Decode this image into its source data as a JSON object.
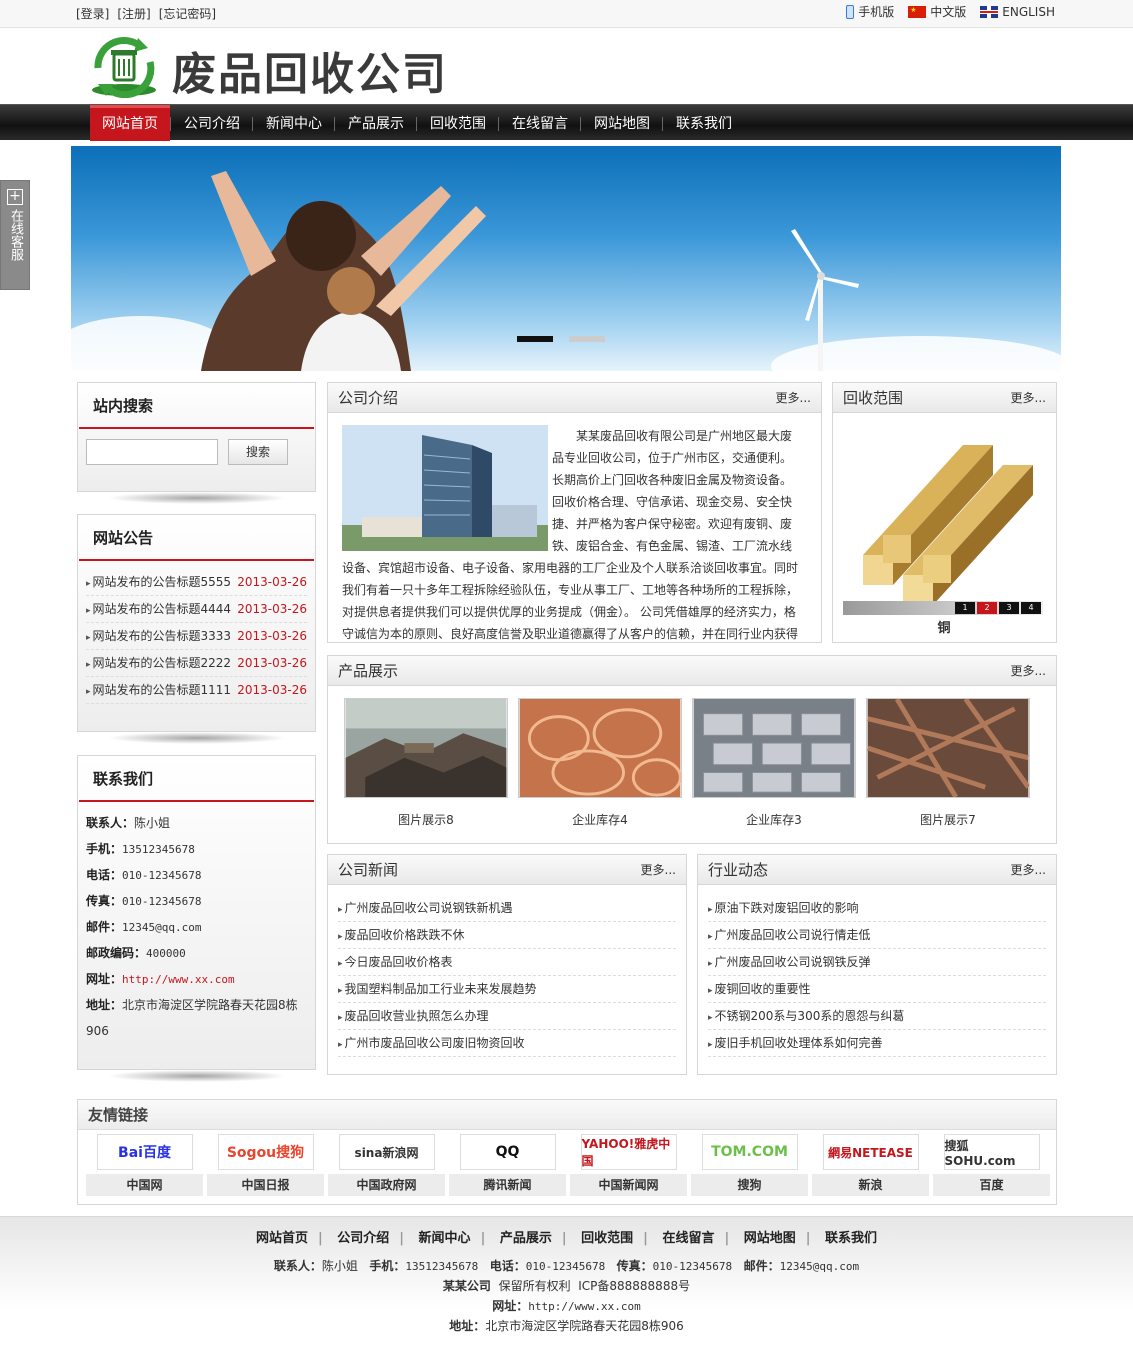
{
  "top": {
    "login": "[登录]",
    "register": "[注册]",
    "forgot": "[忘记密码]",
    "mobile": "手机版",
    "chinese": "中文版",
    "english": "ENGLISH"
  },
  "header": {
    "logo_text": "废品回收公司"
  },
  "nav": [
    "网站首页",
    "公司介绍",
    "新闻中心",
    "产品展示",
    "回收范围",
    "在线留言",
    "网站地图",
    "联系我们"
  ],
  "kefu": {
    "label": "在线客服"
  },
  "search": {
    "title": "站内搜索",
    "button": "搜索",
    "placeholder": ""
  },
  "notice": {
    "title": "网站公告",
    "items": [
      {
        "text": "网站发布的公告标题5555",
        "date": "2013-03-26"
      },
      {
        "text": "网站发布的公告标题4444",
        "date": "2013-03-26"
      },
      {
        "text": "网站发布的公告标题3333",
        "date": "2013-03-26"
      },
      {
        "text": "网站发布的公告标题2222",
        "date": "2013-03-26"
      },
      {
        "text": "网站发布的公告标题1111",
        "date": "2013-03-26"
      }
    ]
  },
  "contact": {
    "title": "联系我们",
    "person_label": "联系人：",
    "person": "陈小姐",
    "phone_label": "手机：",
    "phone": "13512345678",
    "tel_label": "电话：",
    "tel": "010-12345678",
    "fax_label": "传真：",
    "fax": "010-12345678",
    "mail_label": "邮件：",
    "mail": "12345@qq.com",
    "zip_label": "邮政编码：",
    "zip": "400000",
    "url_label": "网址：",
    "url": "http://www.xx.com",
    "addr_label": "地址：",
    "addr": "北京市海淀区学院路春天花园8栋906"
  },
  "about": {
    "title": "公司介绍",
    "more": "更多...",
    "text": "　　某某废品回收有限公司是广州地区最大废品专业回收公司，位于广州市区，交通便利。长期高价上门回收各种废旧金属及物资设备。回收价格合理、守信承诺、现金交易、安全快捷、并严格为客户保守秘密。欢迎有废铜、废铁、废铝合金、有色金属、锡渣、工厂流水线设备、宾馆超市设备、电子设备、家用电器的工厂企业及个人联系洽谈回收事宜。同时我们有着一只十多年工程拆除经验队伍，专业从事工厂、工地等各种场所的工程拆除，对提供息者提供我们可以提供优厚的业务提成（佣金）。 公司凭借雄厚的经济实力，格守诚信为本的原则、良好高度信誉及职业道德赢得了从客户的信赖，并在同行业内获得良好的口碑。我们"
  },
  "recycle": {
    "title": "回收范围",
    "more": "更多...",
    "caption": "铜",
    "pages": [
      "1",
      "2",
      "3",
      "4"
    ]
  },
  "products": {
    "title": "产品展示",
    "more": "更多...",
    "items": [
      "图片展示8",
      "企业库存4",
      "企业库存3",
      "图片展示7"
    ]
  },
  "company_news": {
    "title": "公司新闻",
    "more": "更多...",
    "items": [
      "广州废品回收公司说钢铁新机遇",
      "废品回收价格跌跌不休",
      "今日废品回收价格表",
      "我国塑料制品加工行业未来发展趋势",
      "废品回收营业执照怎么办理",
      "广州市废品回收公司废旧物资回收"
    ]
  },
  "industry_news": {
    "title": "行业动态",
    "more": "更多...",
    "items": [
      "原油下跌对废铝回收的影响",
      "广州废品回收公司说行情走低",
      "广州废品回收公司说钢铁反弹",
      "废铜回收的重要性",
      "不锈钢200系与300系的恩怨与纠葛",
      "废旧手机回收处理体系如何完善"
    ]
  },
  "links": {
    "title": "友情链接",
    "items": [
      {
        "logo": "Bai百度",
        "name": "中国网"
      },
      {
        "logo": "Sogou搜狗",
        "name": "中国日报"
      },
      {
        "logo": "sina新浪网",
        "name": "中国政府网"
      },
      {
        "logo": "QQ",
        "name": "腾讯新闻"
      },
      {
        "logo": "YAHOO!雅虎中国",
        "name": "中国新闻网"
      },
      {
        "logo": "TOM.COM",
        "name": "搜狗"
      },
      {
        "logo": "網易NETEASE",
        "name": "新浪"
      },
      {
        "logo": "搜狐SOHU.com",
        "name": "百度"
      }
    ]
  },
  "footer": {
    "nav": [
      "网站首页",
      "公司介绍",
      "新闻中心",
      "产品展示",
      "回收范围",
      "在线留言",
      "网站地图",
      "联系我们"
    ],
    "person_label": "联系人：",
    "person": "陈小姐",
    "phone_label": "手机：",
    "phone": "13512345678",
    "tel_label": "电话：",
    "tel": "010-12345678",
    "fax_label": "传真：",
    "fax": "010-12345678",
    "mail_label": "邮件：",
    "mail": "12345@qq.com",
    "company": "某某公司",
    "rights": "保留所有权利",
    "icp": "ICP备888888888号",
    "url_label": "网址：",
    "url": "http://www.xx.com",
    "addr_label": "地址：",
    "addr": "北京市海淀区学院路春天花园8栋906"
  }
}
